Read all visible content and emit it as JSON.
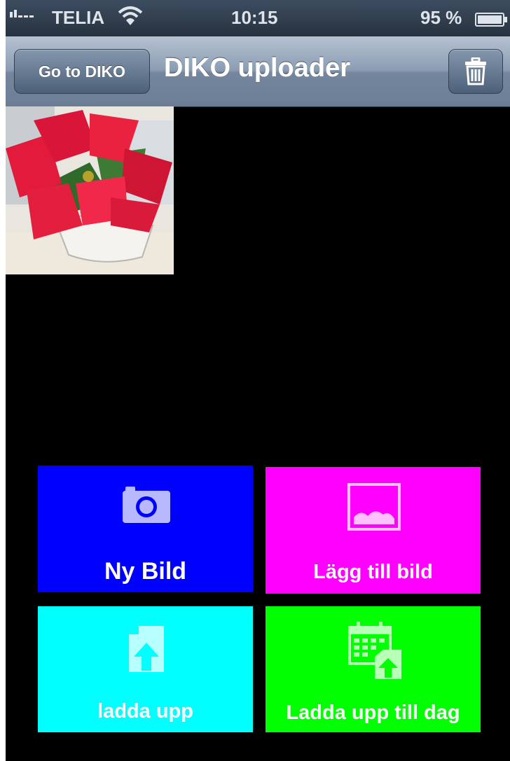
{
  "status_bar": {
    "carrier": "TELIA",
    "time": "10:15",
    "battery": "95 %",
    "icons": [
      "signal-icon",
      "wifi-icon",
      "battery-icon"
    ]
  },
  "nav": {
    "back_label": "Go to DIKO",
    "title": "DIKO uploader",
    "trash_icon": "trash-icon"
  },
  "tiles": [
    {
      "label": "Ny Bild",
      "icon": "camera-icon",
      "color": "#0000ff"
    },
    {
      "label": "Lägg till bild",
      "icon": "image-icon",
      "color": "#ff00ff"
    },
    {
      "label": "ladda upp",
      "icon": "upload-file-icon",
      "color": "#00ffff"
    },
    {
      "label": "Ladda upp till dag",
      "icon": "calendar-upload-icon",
      "color": "#00ff00"
    }
  ]
}
